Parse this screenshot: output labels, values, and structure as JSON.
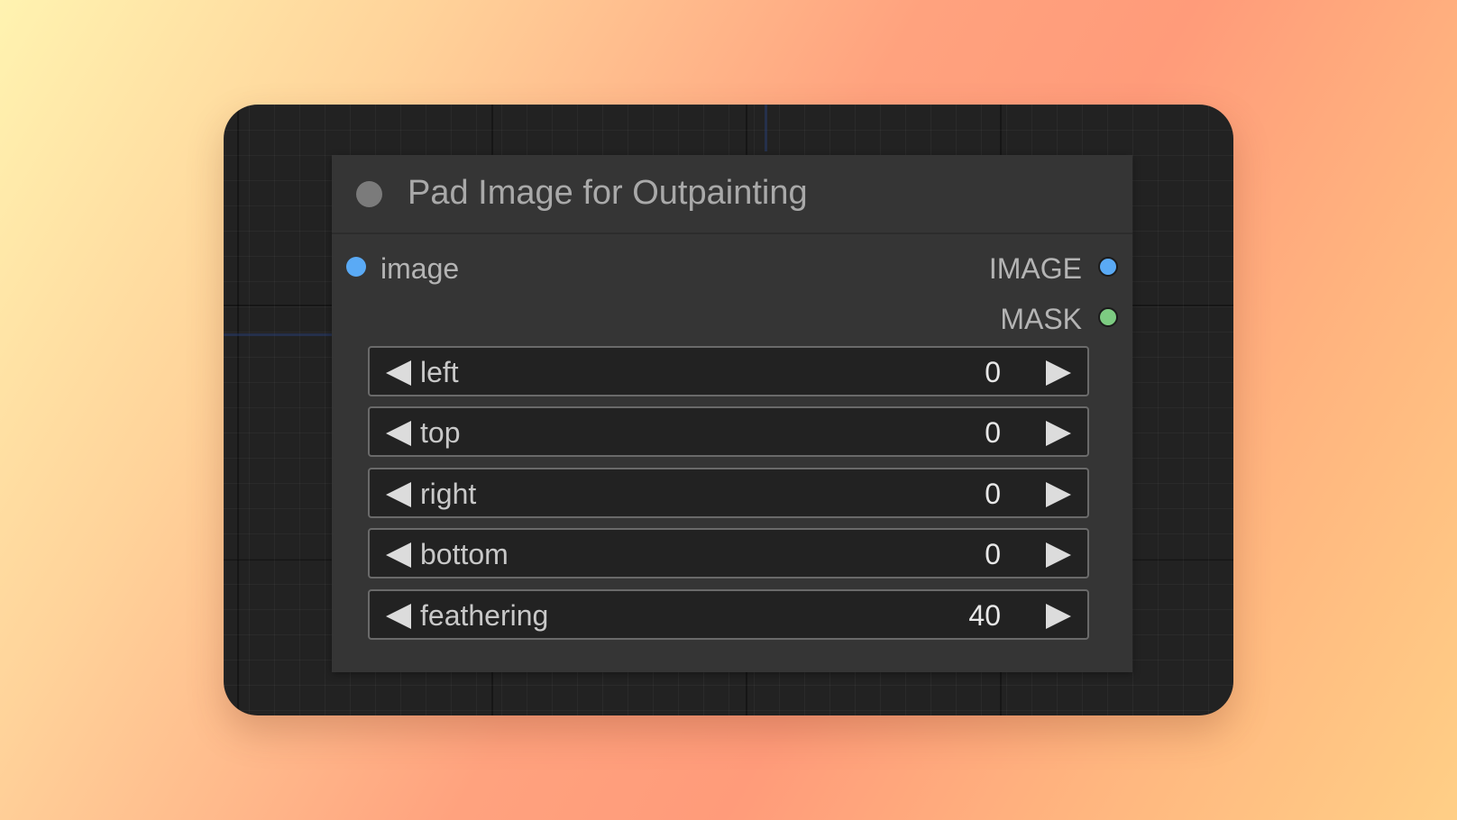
{
  "node": {
    "title": "Pad Image for Outpainting",
    "inputs": [
      {
        "label": "image",
        "color": "#5aaaf5"
      }
    ],
    "outputs": [
      {
        "label": "IMAGE",
        "color": "#5aaaf5"
      },
      {
        "label": "MASK",
        "color": "#7dcc82"
      }
    ],
    "widgets": [
      {
        "label": "left",
        "value": "0"
      },
      {
        "label": "top",
        "value": "0"
      },
      {
        "label": "right",
        "value": "0"
      },
      {
        "label": "bottom",
        "value": "0"
      },
      {
        "label": "feathering",
        "value": "40"
      }
    ]
  },
  "icons": {
    "decrement": "triangle-left-icon",
    "increment": "triangle-right-icon",
    "collapse": "collapse-dot-icon"
  }
}
